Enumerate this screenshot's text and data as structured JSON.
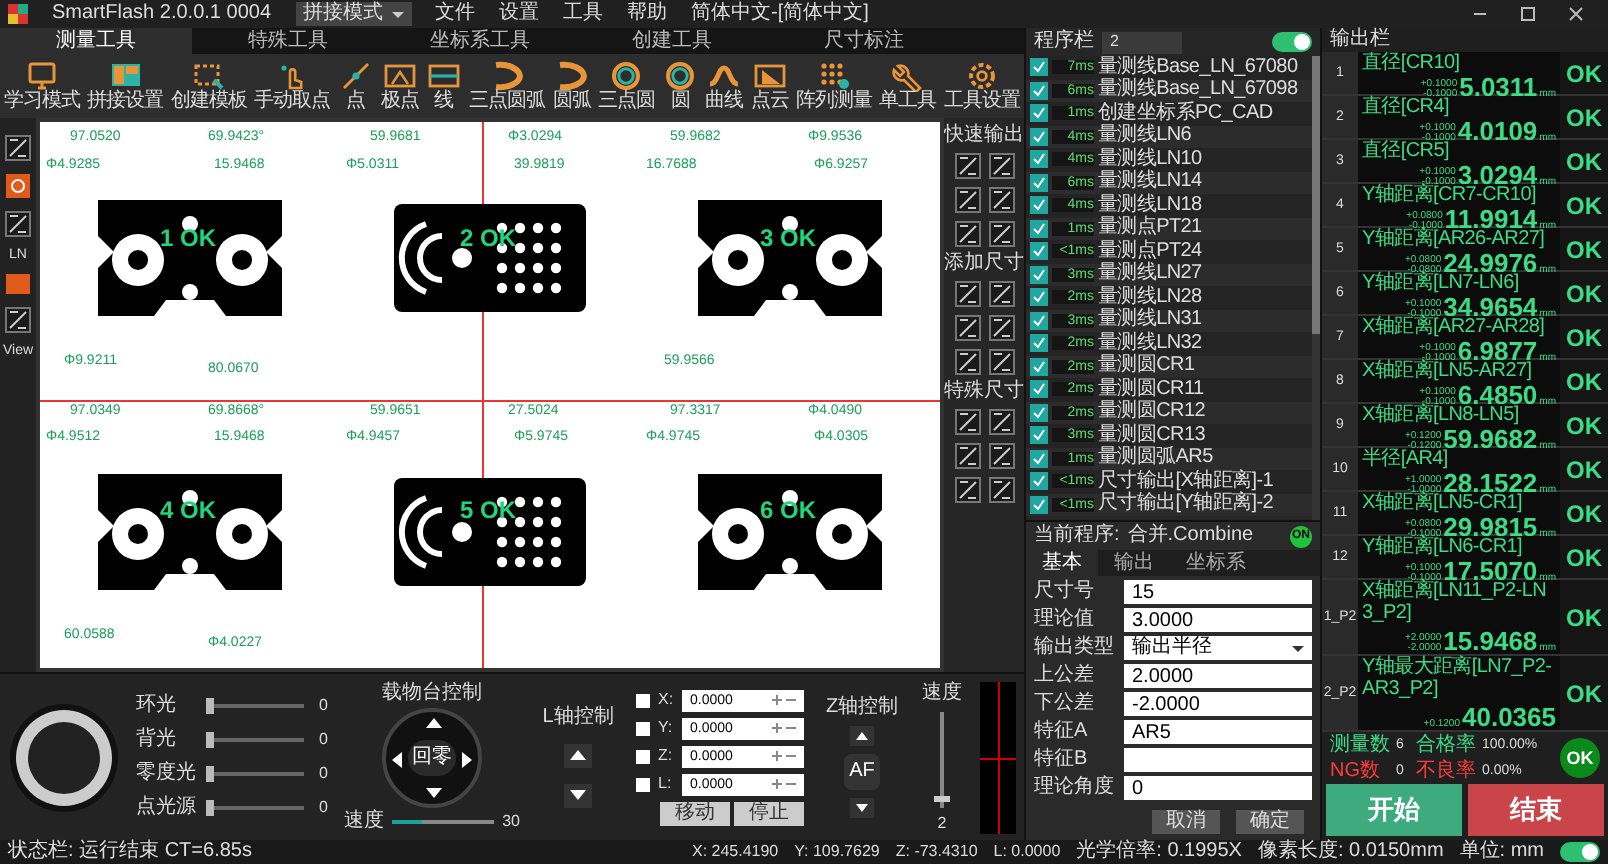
{
  "app": {
    "title": "SmartFlash 2.0.0.1 0004",
    "mode": "拼接模式",
    "menus": [
      "文件",
      "设置",
      "工具",
      "帮助",
      "简体中文-[简体中文]"
    ]
  },
  "tabs": [
    {
      "label": "测量工具",
      "selected": true
    },
    {
      "label": "特殊工具",
      "selected": false
    },
    {
      "label": "坐标系工具",
      "selected": false
    },
    {
      "label": "创建工具",
      "selected": false
    },
    {
      "label": "尺寸标注",
      "selected": false
    }
  ],
  "toolbar": [
    {
      "kind": "monitor",
      "label": "学习模式"
    },
    {
      "kind": "layout",
      "label": "拼接设置"
    },
    {
      "kind": "template",
      "label": "创建模板"
    },
    {
      "kind": "hand",
      "label": "手动取点"
    },
    {
      "kind": "point",
      "label": "点"
    },
    {
      "kind": "pole",
      "label": "极点"
    },
    {
      "kind": "line",
      "label": "线"
    },
    {
      "kind": "arc3",
      "label": "三点圆弧"
    },
    {
      "kind": "arc",
      "label": "圆弧"
    },
    {
      "kind": "circle3",
      "label": "三点圆"
    },
    {
      "kind": "circle",
      "label": "圆"
    },
    {
      "kind": "curve",
      "label": "曲线"
    },
    {
      "kind": "cloud",
      "label": "点云"
    },
    {
      "kind": "array",
      "label": "阵列测量"
    },
    {
      "kind": "wrench",
      "label": "单工具"
    },
    {
      "kind": "gear",
      "label": "工具设置"
    }
  ],
  "side_labels": [
    "LN",
    "View"
  ],
  "canvas": {
    "parts": [
      {
        "kind": "bracket",
        "label": "1 OK",
        "dims": [
          "97.0520",
          "69.9423°",
          "Φ4.9285",
          "15.9468",
          "Φ9.9211",
          "80.0670"
        ]
      },
      {
        "kind": "plate",
        "label": "2 OK",
        "dims": [
          "59.9681",
          "Φ3.0294",
          "Φ5.0311",
          "39.9819"
        ]
      },
      {
        "kind": "bracket",
        "label": "3 OK",
        "dims": [
          "59.9682",
          "Φ9.9536",
          "16.7688",
          "Φ6.9257",
          "59.9566"
        ]
      },
      {
        "kind": "bracket",
        "label": "4 OK",
        "dims": [
          "97.0349",
          "69.8668°",
          "Φ4.9512",
          "15.9468",
          "60.0588",
          "Φ4.0227"
        ]
      },
      {
        "kind": "plate",
        "label": "5 OK",
        "dims": [
          "59.9651",
          "27.5024",
          "Φ4.9457",
          "Φ5.9745"
        ]
      },
      {
        "kind": "bracket",
        "label": "6 OK",
        "dims": [
          "97.3317",
          "Φ4.0490",
          "Φ4.9745",
          "Φ4.0305"
        ]
      }
    ]
  },
  "quick_panel": {
    "sections": [
      "快速输出",
      "添加尺寸",
      "特殊尺寸"
    ]
  },
  "program": {
    "label": "程序栏",
    "value": "2",
    "auto_on": true,
    "steps": [
      {
        "checked": true,
        "time": "7ms",
        "name": "量测线Base_LN_67080"
      },
      {
        "checked": true,
        "time": "6ms",
        "name": "量测线Base_LN_67098"
      },
      {
        "checked": true,
        "time": "1ms",
        "name": "创建坐标系PC_CAD"
      },
      {
        "checked": true,
        "time": "4ms",
        "name": "量测线LN6"
      },
      {
        "checked": true,
        "time": "4ms",
        "name": "量测线LN10"
      },
      {
        "checked": true,
        "time": "6ms",
        "name": "量测线LN14"
      },
      {
        "checked": true,
        "time": "4ms",
        "name": "量测线LN18"
      },
      {
        "checked": true,
        "time": "1ms",
        "name": "量测点PT21"
      },
      {
        "checked": true,
        "time": "<1ms",
        "name": "量测点PT24"
      },
      {
        "checked": true,
        "time": "3ms",
        "name": "量测线LN27"
      },
      {
        "checked": true,
        "time": "2ms",
        "name": "量测线LN28"
      },
      {
        "checked": true,
        "time": "3ms",
        "name": "量测线LN31"
      },
      {
        "checked": true,
        "time": "2ms",
        "name": "量测线LN32"
      },
      {
        "checked": true,
        "time": "2ms",
        "name": "量测圆CR1"
      },
      {
        "checked": true,
        "time": "2ms",
        "name": "量测圆CR11"
      },
      {
        "checked": true,
        "time": "2ms",
        "name": "量测圆CR12"
      },
      {
        "checked": true,
        "time": "3ms",
        "name": "量测圆CR13"
      },
      {
        "checked": true,
        "time": "1ms",
        "name": "量测圆弧AR5"
      },
      {
        "checked": true,
        "time": "<1ms",
        "name": "尺寸输出[X轴距离]-1"
      },
      {
        "checked": true,
        "time": "<1ms",
        "name": "尺寸输出[Y轴距离]-2"
      }
    ]
  },
  "properties": {
    "current_label": "当前程序:",
    "current": "合并.Combine",
    "badge": "ON",
    "tabs": [
      {
        "label": "基本",
        "selected": true
      },
      {
        "label": "输出",
        "selected": false
      },
      {
        "label": "坐标系",
        "selected": false
      }
    ],
    "fields": [
      {
        "kind": "text",
        "label": "尺寸号",
        "value": "15"
      },
      {
        "kind": "text",
        "label": "理论值",
        "value": "3.0000"
      },
      {
        "kind": "select",
        "label": "输出类型",
        "value": "输出半径"
      },
      {
        "kind": "text",
        "label": "上公差",
        "value": "2.0000"
      },
      {
        "kind": "text",
        "label": "下公差",
        "value": "-2.0000"
      },
      {
        "kind": "text",
        "label": "特征A",
        "value": "AR5"
      },
      {
        "kind": "text",
        "label": "特征B"
      },
      {
        "kind": "text",
        "label": "理论角度",
        "value": "0"
      }
    ],
    "buttons": [
      "取消",
      "确定"
    ]
  },
  "output": {
    "label": "输出栏",
    "rows": [
      {
        "index": "1",
        "name": "直径[CR10]",
        "upper": "+0.1000",
        "lower": "-0.1000",
        "value": "5.0311",
        "unit": "mm",
        "result": "OK"
      },
      {
        "index": "2",
        "name": "直径[CR4]",
        "upper": "+0.1000",
        "lower": "-0.1000",
        "value": "4.0109",
        "unit": "mm",
        "result": "OK"
      },
      {
        "index": "3",
        "name": "直径[CR5]",
        "upper": "+0.1000",
        "lower": "-0.1000",
        "value": "3.0294",
        "unit": "mm",
        "result": "OK"
      },
      {
        "index": "4",
        "name": "Y轴距离[CR7-CR10]",
        "upper": "+0.0800",
        "lower": "-0.1000",
        "value": "11.9914",
        "unit": "mm",
        "result": "OK"
      },
      {
        "index": "5",
        "name": "Y轴距离[AR26-AR27]",
        "upper": "+0.0800",
        "lower": "-0.0800",
        "value": "24.9976",
        "unit": "mm",
        "result": "OK"
      },
      {
        "index": "6",
        "name": "Y轴距离[LN7-LN6]",
        "upper": "+0.1000",
        "lower": "-0.1000",
        "value": "34.9654",
        "unit": "mm",
        "result": "OK"
      },
      {
        "index": "7",
        "name": "X轴距离[AR27-AR28]",
        "upper": "+0.1000",
        "lower": "-0.1000",
        "value": "6.9877",
        "unit": "mm",
        "result": "OK"
      },
      {
        "index": "8",
        "name": "X轴距离[LN5-AR27]",
        "upper": "+0.1000",
        "lower": "-0.1000",
        "value": "6.4850",
        "unit": "mm",
        "result": "OK"
      },
      {
        "index": "9",
        "name": "X轴距离[LN8-LN5]",
        "upper": "+0.1200",
        "lower": "-0.1200",
        "value": "59.9682",
        "unit": "mm",
        "result": "OK"
      },
      {
        "index": "10",
        "name": "半径[AR4]",
        "upper": "+1.0000",
        "lower": "-1.0000",
        "value": "28.1522",
        "unit": "mm",
        "result": "OK"
      },
      {
        "index": "11",
        "name": "X轴距离[LN5-CR1]",
        "upper": "+0.0800",
        "lower": "-0.1000",
        "value": "29.9815",
        "unit": "mm",
        "result": "OK"
      },
      {
        "index": "12",
        "name": "Y轴距离[LN6-CR1]",
        "upper": "+0.1000",
        "lower": "-0.1000",
        "value": "17.5070",
        "unit": "mm",
        "result": "OK"
      },
      {
        "index": "1_P2",
        "name": "X轴距离[LN11_P2-LN3_P2]",
        "upper": "+2.0000",
        "lower": "-2.0000",
        "value": "15.9468",
        "unit": "mm",
        "result": "OK"
      },
      {
        "index": "2_P2",
        "name": "Y轴最大距离[LN7_P2-AR3_P2]",
        "upper": "+0.1200",
        "value": "40.0365",
        "result": "OK"
      }
    ],
    "stats": [
      {
        "label": "测量数",
        "value": "6",
        "color": "#3ddc84"
      },
      {
        "label": "合格率",
        "value": "100.00%",
        "color": "#3ddc84"
      },
      {
        "label": "NG数",
        "value": "0",
        "color": "#ff3b3b"
      },
      {
        "label": "不良率",
        "value": "0.00%",
        "color": "#ff3b3b"
      }
    ],
    "result": "OK",
    "start": "开始",
    "stop": "结束"
  },
  "lights": [
    {
      "label": "环光",
      "value": "0",
      "level": 0
    },
    {
      "label": "背光",
      "value": "0",
      "level": 0
    },
    {
      "label": "零度光",
      "value": "0",
      "level": 0
    },
    {
      "label": "点光源",
      "value": "0",
      "level": 0
    }
  ],
  "stage": {
    "title": "载物台控制",
    "home": "回零",
    "speed_label": "速度",
    "speed": "30",
    "level": 0.3
  },
  "l_axis": {
    "title": "L轴控制"
  },
  "axes": [
    {
      "label": "X:",
      "value": "0.0000",
      "checked": false
    },
    {
      "label": "Y:",
      "value": "0.0000",
      "checked": false
    },
    {
      "label": "Z:",
      "value": "0.0000",
      "checked": false
    },
    {
      "label": "L:",
      "value": "0.0000",
      "checked": false
    }
  ],
  "axis_buttons": [
    "移动",
    "停止"
  ],
  "z_axis": {
    "title": "Z轴控制",
    "af": "AF"
  },
  "z_speed": {
    "label": "速度",
    "value": "2",
    "level": 0.05
  },
  "status_bar": {
    "status": "状态栏: 运行结束 CT=6.85s",
    "coords": [
      "X: 245.4190",
      "Y: 109.7629",
      "Z: -73.4310",
      "L: 0.0000"
    ],
    "magnification": "光学倍率: 0.1995X",
    "pixel": "像素长度: 0.0150mm",
    "unit": "单位: mm",
    "unit_toggle": true
  }
}
